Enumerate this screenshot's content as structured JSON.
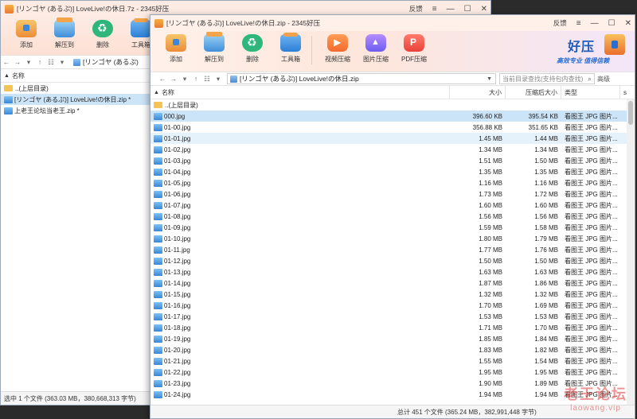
{
  "back_window": {
    "title": "[リンゴヤ (あるぷ)] LoveLive!の休日.7z - 2345好压",
    "feedback": "反馈",
    "toolbar": [
      "添加",
      "解压到",
      "删除",
      "工具箱"
    ],
    "path": "[リンゴヤ (あるぷ)",
    "col_name": "名称",
    "rows": [
      "..(上层目录)",
      "[リンゴヤ (あるぷ)] LoveLive!の休日.zip *",
      "上老王论坛当老王.zip *"
    ],
    "status": "选中 1 个文件 (363.03 MB，380,668,313 字节)"
  },
  "front_window": {
    "title": "[リンゴヤ (あるぷ)] LoveLive!の休日.zip - 2345好压",
    "feedback": "反馈",
    "toolbar": {
      "add": "添加",
      "extract": "解压到",
      "delete": "删除",
      "toolbox": "工具箱",
      "video": "视频压缩",
      "image": "图片压缩",
      "pdf": "PDF压缩"
    },
    "brand": {
      "name": "好压",
      "slogan": "高效专业  值得信赖"
    },
    "path": "[リンゴヤ (あるぷ)] LoveLive!の休日.zip",
    "search_placeholder": "当前目录查找(支持包内查找)",
    "advanced": "高级",
    "columns": {
      "name": "名称",
      "size": "大小",
      "csize": "压缩后大小",
      "type": "类型"
    },
    "parent_dir": "..(上层目录)",
    "files": [
      {
        "name": "000.jpg",
        "size": "396.60 KB",
        "csize": "395.54 KB",
        "type": "看图王 JPG 图片..."
      },
      {
        "name": "01-00.jpg",
        "size": "356.88 KB",
        "csize": "351.65 KB",
        "type": "看图王 JPG 图片..."
      },
      {
        "name": "01-01.jpg",
        "size": "1.45 MB",
        "csize": "1.44 MB",
        "type": "看图王 JPG 图片..."
      },
      {
        "name": "01-02.jpg",
        "size": "1.34 MB",
        "csize": "1.34 MB",
        "type": "看图王 JPG 图片..."
      },
      {
        "name": "01-03.jpg",
        "size": "1.51 MB",
        "csize": "1.50 MB",
        "type": "看图王 JPG 图片..."
      },
      {
        "name": "01-04.jpg",
        "size": "1.35 MB",
        "csize": "1.35 MB",
        "type": "看图王 JPG 图片..."
      },
      {
        "name": "01-05.jpg",
        "size": "1.16 MB",
        "csize": "1.16 MB",
        "type": "看图王 JPG 图片..."
      },
      {
        "name": "01-06.jpg",
        "size": "1.73 MB",
        "csize": "1.72 MB",
        "type": "看图王 JPG 图片..."
      },
      {
        "name": "01-07.jpg",
        "size": "1.60 MB",
        "csize": "1.60 MB",
        "type": "看图王 JPG 图片..."
      },
      {
        "name": "01-08.jpg",
        "size": "1.56 MB",
        "csize": "1.56 MB",
        "type": "看图王 JPG 图片..."
      },
      {
        "name": "01-09.jpg",
        "size": "1.59 MB",
        "csize": "1.58 MB",
        "type": "看图王 JPG 图片..."
      },
      {
        "name": "01-10.jpg",
        "size": "1.80 MB",
        "csize": "1.79 MB",
        "type": "看图王 JPG 图片..."
      },
      {
        "name": "01-11.jpg",
        "size": "1.77 MB",
        "csize": "1.76 MB",
        "type": "看图王 JPG 图片..."
      },
      {
        "name": "01-12.jpg",
        "size": "1.50 MB",
        "csize": "1.50 MB",
        "type": "看图王 JPG 图片..."
      },
      {
        "name": "01-13.jpg",
        "size": "1.63 MB",
        "csize": "1.63 MB",
        "type": "看图王 JPG 图片..."
      },
      {
        "name": "01-14.jpg",
        "size": "1.87 MB",
        "csize": "1.86 MB",
        "type": "看图王 JPG 图片..."
      },
      {
        "name": "01-15.jpg",
        "size": "1.32 MB",
        "csize": "1.32 MB",
        "type": "看图王 JPG 图片..."
      },
      {
        "name": "01-16.jpg",
        "size": "1.70 MB",
        "csize": "1.69 MB",
        "type": "看图王 JPG 图片..."
      },
      {
        "name": "01-17.jpg",
        "size": "1.53 MB",
        "csize": "1.53 MB",
        "type": "看图王 JPG 图片..."
      },
      {
        "name": "01-18.jpg",
        "size": "1.71 MB",
        "csize": "1.70 MB",
        "type": "看图王 JPG 图片..."
      },
      {
        "name": "01-19.jpg",
        "size": "1.85 MB",
        "csize": "1.84 MB",
        "type": "看图王 JPG 图片..."
      },
      {
        "name": "01-20.jpg",
        "size": "1.83 MB",
        "csize": "1.82 MB",
        "type": "看图王 JPG 图片..."
      },
      {
        "name": "01-21.jpg",
        "size": "1.55 MB",
        "csize": "1.54 MB",
        "type": "看图王 JPG 图片..."
      },
      {
        "name": "01-22.jpg",
        "size": "1.95 MB",
        "csize": "1.95 MB",
        "type": "看图王 JPG 图片..."
      },
      {
        "name": "01-23.jpg",
        "size": "1.90 MB",
        "csize": "1.89 MB",
        "type": "看图王 JPG 图片..."
      },
      {
        "name": "01-24.jpg",
        "size": "1.94 MB",
        "csize": "1.94 MB",
        "type": "看图王 JPG 图片..."
      }
    ],
    "status": "总计 451 个文件 (365.24 MB，382,991,448 字节)"
  },
  "watermark": {
    "text": "老王论坛",
    "url": "laowang.vip"
  }
}
